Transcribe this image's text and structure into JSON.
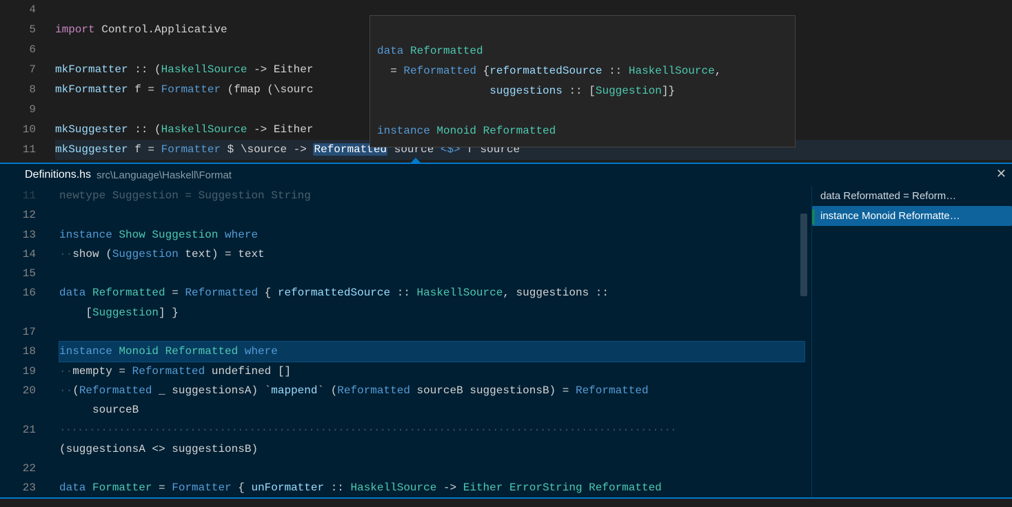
{
  "top_editor": {
    "line_numbers": [
      "4",
      "5",
      "6",
      "7",
      "8",
      "9",
      "10",
      "11"
    ],
    "lines": {
      "l5_import": "import",
      "l5_mod": " Control.Applicative",
      "l7_name": "mkFormatter",
      "l7_rest": " :: (",
      "l7_type": "HaskellSource",
      "l7_tail": " -> Either",
      "l8_name": "mkFormatter",
      "l8_eq": " f = ",
      "l8_ctor": "Formatter",
      "l8_tail": " (fmap (\\sourc",
      "l10_name": "mkSuggester",
      "l10_rest": " :: (",
      "l10_type": "HaskellSource",
      "l10_tail": " -> Either",
      "l11_name": "mkSuggester",
      "l11_eq": " f = ",
      "l11_ctor": "Formatter",
      "l11_mid": " $ \\source -> ",
      "l11_sel": "Reformatted",
      "l11_tail1": " source ",
      "l11_op": "<$>",
      "l11_tail2": " f source"
    }
  },
  "hover": {
    "l1_kw": "data",
    "l1_type": " Reformatted",
    "l2_pre": "  = ",
    "l2_ctor": "Reformatted",
    "l2_brace": " {",
    "l2_field": "reformattedSource",
    "l2_colon": " :: ",
    "l2_type": "HaskellSource",
    "l2_comma": ",",
    "l3_field": "                 suggestions",
    "l3_colon": " :: [",
    "l3_type": "Suggestion",
    "l3_close": "]}",
    "l5_kw": "instance",
    "l5_cls": " Monoid",
    "l5_type": " Reformatted"
  },
  "peek": {
    "file": "Definitions.hs",
    "path": "src\\Language\\Haskell\\Format",
    "line_numbers": [
      "11",
      "12",
      "13",
      "14",
      "15",
      "16",
      "",
      "17",
      "18",
      "19",
      "20",
      "",
      "21",
      "",
      "22",
      "23"
    ],
    "side": [
      "data Reformatted = Reform…",
      "instance Monoid Reformatte…"
    ],
    "lines": {
      "l11_cut": "newtype Suggestion = Suggestion String",
      "l13_a": "instance",
      "l13_b": " Show",
      "l13_c": " Suggestion",
      "l13_d": " where",
      "l14_ws": "··",
      "l14_a": "show (",
      "l14_b": "Suggestion",
      "l14_c": " text) = text",
      "l16_a": "data",
      "l16_b": " Reformatted",
      "l16_c": " = ",
      "l16_d": "Reformatted",
      "l16_e": " { ",
      "l16_f": "reformattedSource",
      "l16_g": " :: ",
      "l16_h": "HaskellSource",
      "l16_i": ", suggestions :: ",
      "l16b_a": "    [",
      "l16b_b": "Suggestion",
      "l16b_c": "] }",
      "l18_a": "instance",
      "l18_b": " Monoid",
      "l18_c": " Reformatted",
      "l18_d": " where",
      "l19_ws": "··",
      "l19_a": "mempty = ",
      "l19_b": "Reformatted",
      "l19_c": " undefined []",
      "l20_ws": "··",
      "l20_a": "(",
      "l20_b": "Reformatted",
      "l20_c": " _ suggestionsA) `",
      "l20_d": "mappend",
      "l20_e": "` (",
      "l20_f": "Reformatted",
      "l20_g": " sourceB suggestionsB) = ",
      "l20_h": "Reformatted",
      "l20b_a": "     sourceB",
      "l21_dots": "········································································································",
      "l21b_a": "(suggestionsA <> suggestionsB)",
      "l23_a": "data",
      "l23_b": " Formatter",
      "l23_c": " = ",
      "l23_d": "Formatter",
      "l23_e": " { ",
      "l23_f": "unFormatter",
      "l23_g": " :: ",
      "l23_h": "HaskellSource",
      "l23_i": " -> ",
      "l23_j": "Either",
      "l23_k": " ErrorString",
      "l23_l": " Reformatted"
    }
  }
}
